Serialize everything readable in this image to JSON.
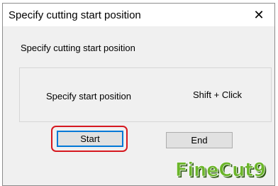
{
  "window": {
    "title": "Specify cutting start position",
    "close_glyph": "✕",
    "close_icon": "close-icon"
  },
  "dialog": {
    "subtitle": "Specify cutting start position",
    "instruction_label": "Specify start position",
    "instruction_shortcut": "Shift + Click"
  },
  "buttons": {
    "start_label": "Start",
    "end_label": "End"
  },
  "branding": {
    "logo_text": "FineCut9",
    "logo_color": "#6bb52a",
    "logo_shadow": "#2d5a10"
  },
  "colors": {
    "highlight": "#d6181f",
    "focus": "#0078d7"
  }
}
